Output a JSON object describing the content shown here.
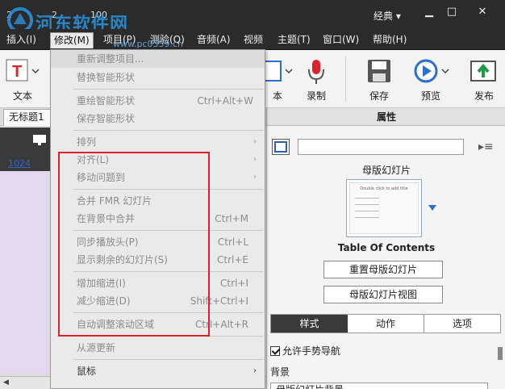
{
  "titlebar": {
    "nums": [
      "2",
      "2",
      "100"
    ],
    "mode": "经典",
    "watermark": "河东软件网",
    "watermark_url": "www.pc0359.cn"
  },
  "menubar": {
    "items": [
      "插入(I)",
      "修改(M)",
      "项目(P)",
      "测验(Q)",
      "音频(A)",
      "视频",
      "主题(T)",
      "窗口(W)",
      "帮助(H)"
    ]
  },
  "toolbar": {
    "text": "文本",
    "shape": "本",
    "record": "录制",
    "save": "保存",
    "preview": "预览",
    "publish": "发布"
  },
  "doc": {
    "tab": "无标题1",
    "slide_number": "1024"
  },
  "dropdown": {
    "items": [
      {
        "label": "重新调整项目...",
        "shortcut": "",
        "submenu": false
      },
      {
        "label": "替换智能形状",
        "shortcut": "",
        "submenu": false
      },
      {
        "label": "重绘智能形状",
        "shortcut": "Ctrl+Alt+W",
        "submenu": false
      },
      {
        "label": "保存智能形状",
        "shortcut": "",
        "submenu": false
      },
      {
        "label": "排列",
        "shortcut": "",
        "submenu": true
      },
      {
        "label": "对齐(L)",
        "shortcut": "",
        "submenu": true
      },
      {
        "label": "移动问题到",
        "shortcut": "",
        "submenu": true
      },
      {
        "label": "合并 FMR 幻灯片",
        "shortcut": "",
        "submenu": false
      },
      {
        "label": "在背景中合并",
        "shortcut": "Ctrl+M",
        "submenu": false
      },
      {
        "label": "同步播放头(P)",
        "shortcut": "Ctrl+L",
        "submenu": false
      },
      {
        "label": "显示剩余的幻灯片(S)",
        "shortcut": "Ctrl+E",
        "submenu": false
      },
      {
        "label": "增加缩进(I)",
        "shortcut": "Ctrl+I",
        "submenu": false
      },
      {
        "label": "减少缩进(D)",
        "shortcut": "Shift+Ctrl+I",
        "submenu": false
      },
      {
        "label": "自动调整滚动区域",
        "shortcut": "Ctrl+Alt+R",
        "submenu": false
      },
      {
        "label": "从源更新",
        "shortcut": "",
        "submenu": false
      },
      {
        "label": "鼠标",
        "shortcut": "",
        "submenu": true
      }
    ]
  },
  "panel": {
    "header": "属性",
    "master_title": "母版幻灯片",
    "thumb_title": "Double click to add title",
    "master_name": "Table Of Contents",
    "reset_btn": "重置母版幻灯片",
    "view_btn": "母版幻灯片视图",
    "tabs": [
      "样式",
      "动作",
      "选项"
    ],
    "gesture": "允许手势导航",
    "background_label": "背景",
    "background_value": "母版幻灯片背景"
  }
}
